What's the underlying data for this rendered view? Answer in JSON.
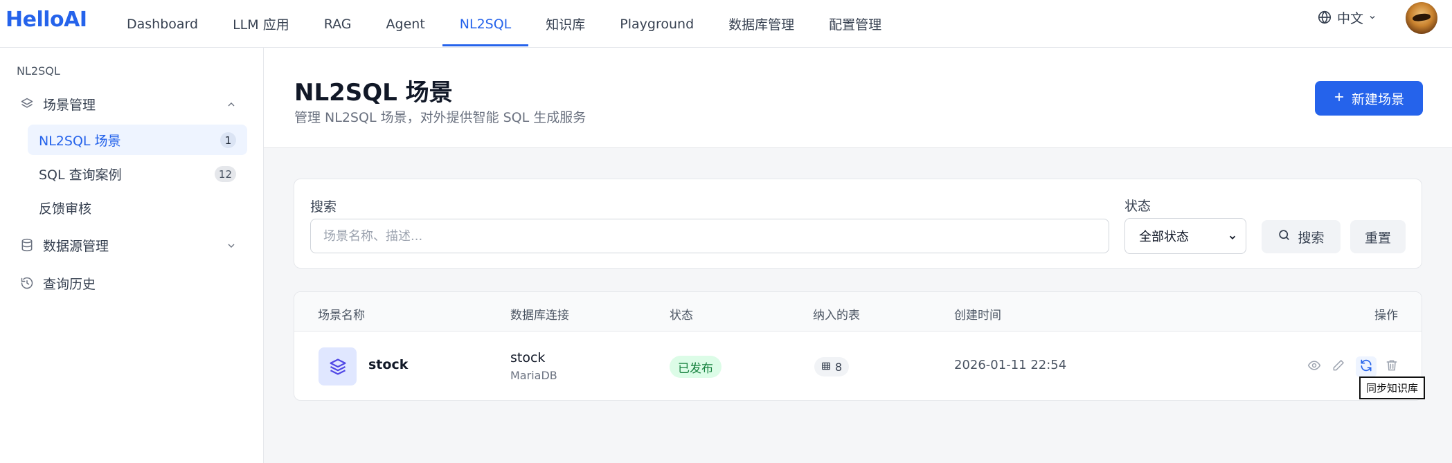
{
  "app": {
    "logo": "HelloAI"
  },
  "nav": {
    "items": [
      {
        "label": "Dashboard"
      },
      {
        "label": "LLM 应用"
      },
      {
        "label": "RAG"
      },
      {
        "label": "Agent"
      },
      {
        "label": "NL2SQL"
      },
      {
        "label": "知识库"
      },
      {
        "label": "Playground"
      },
      {
        "label": "数据库管理"
      },
      {
        "label": "配置管理"
      }
    ],
    "active_index": 4,
    "language": "中文"
  },
  "sidebar": {
    "section_title": "NL2SQL",
    "groups": [
      {
        "label": "场景管理",
        "icon": "layers-icon",
        "expanded": true
      },
      {
        "label": "数据源管理",
        "icon": "database-icon",
        "expanded": false
      },
      {
        "label": "查询历史",
        "icon": "history-icon"
      }
    ],
    "items": [
      {
        "label": "NL2SQL 场景",
        "count": "1",
        "active": true
      },
      {
        "label": "SQL 查询案例",
        "count": "12"
      },
      {
        "label": "反馈审核"
      }
    ]
  },
  "header": {
    "title": "NL2SQL 场景",
    "subtitle": "管理 NL2SQL 场景，对外提供智能 SQL 生成服务",
    "new_button": "新建场景"
  },
  "filter": {
    "search_label": "搜索",
    "search_placeholder": "场景名称、描述...",
    "search_value": "",
    "status_label": "状态",
    "status_value": "全部状态",
    "search_button": "搜索",
    "reset_button": "重置"
  },
  "table": {
    "columns": [
      "场景名称",
      "数据库连接",
      "状态",
      "纳入的表",
      "创建时间",
      "操作"
    ],
    "rows": [
      {
        "name": "stock",
        "db_name": "stock",
        "db_type": "MariaDB",
        "status": "已发布",
        "tables": "8",
        "created": "2026-01-11 22:54"
      }
    ]
  },
  "tooltip": {
    "text": "同步知识库"
  },
  "colors": {
    "primary": "#2563eb",
    "success_bg": "#dcfce7",
    "success_text": "#15803d"
  }
}
